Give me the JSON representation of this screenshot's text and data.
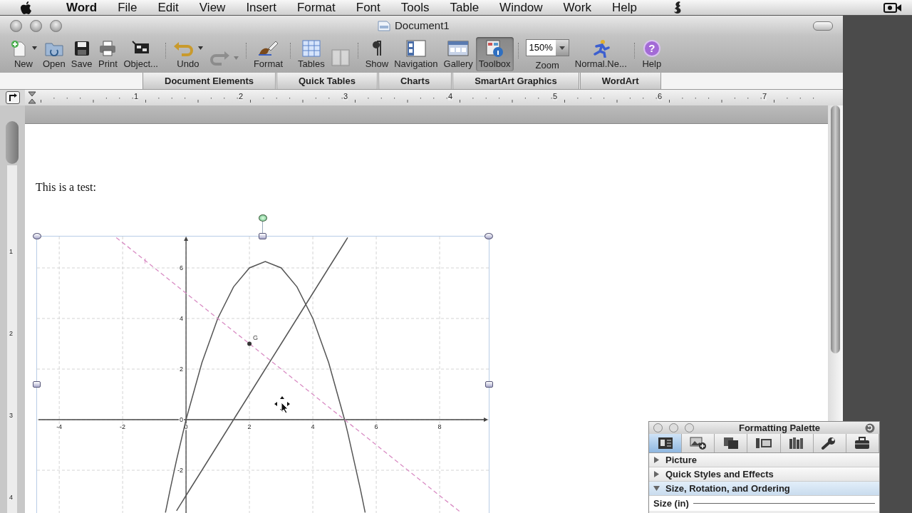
{
  "menu_bar": {
    "items": [
      {
        "label": "Word"
      },
      {
        "label": "File"
      },
      {
        "label": "Edit"
      },
      {
        "label": "View"
      },
      {
        "label": "Insert"
      },
      {
        "label": "Format"
      },
      {
        "label": "Font"
      },
      {
        "label": "Tools"
      },
      {
        "label": "Table"
      },
      {
        "label": "Window"
      },
      {
        "label": "Work"
      },
      {
        "label": "Help"
      }
    ]
  },
  "window": {
    "title": "Document1"
  },
  "toolbar": [
    {
      "kind": "button",
      "label": "New",
      "dropdown": true,
      "disabled": false,
      "selected": false
    },
    {
      "kind": "button",
      "label": "Open",
      "dropdown": false,
      "disabled": false,
      "selected": false
    },
    {
      "kind": "button",
      "label": "Save",
      "dropdown": false,
      "disabled": false,
      "selected": false
    },
    {
      "kind": "button",
      "label": "Print",
      "dropdown": false,
      "disabled": false,
      "selected": false
    },
    {
      "kind": "button",
      "label": "Object...",
      "dropdown": false,
      "disabled": false,
      "selected": false
    },
    {
      "kind": "separator"
    },
    {
      "kind": "button",
      "label": "Undo",
      "dropdown": true,
      "disabled": false,
      "selected": false
    },
    {
      "kind": "button",
      "dropdown": true,
      "disabled": true,
      "selected": false
    },
    {
      "kind": "separator"
    },
    {
      "kind": "button",
      "label": "Format",
      "dropdown": false,
      "disabled": false,
      "selected": false
    },
    {
      "kind": "separator"
    },
    {
      "kind": "button",
      "label": "Tables",
      "dropdown": false,
      "disabled": false,
      "selected": false
    },
    {
      "kind": "button",
      "dropdown": false,
      "disabled": true,
      "selected": false
    },
    {
      "kind": "separator"
    },
    {
      "kind": "button",
      "label": "Show",
      "dropdown": false,
      "disabled": false,
      "selected": false
    },
    {
      "kind": "button",
      "label": "Navigation",
      "dropdown": false,
      "disabled": false,
      "selected": false
    },
    {
      "kind": "button",
      "label": "Gallery",
      "dropdown": false,
      "disabled": false,
      "selected": false
    },
    {
      "kind": "button",
      "label": "Toolbox",
      "dropdown": false,
      "disabled": false,
      "selected": true
    },
    {
      "kind": "separator"
    },
    {
      "kind": "zoom",
      "value": "150%",
      "label": "Zoom"
    },
    {
      "kind": "button",
      "label": "Normal.Ne...",
      "dropdown": false,
      "disabled": false,
      "selected": false
    },
    {
      "kind": "separator"
    },
    {
      "kind": "button",
      "glyph": "?",
      "label": "Help",
      "dropdown": false,
      "disabled": false,
      "selected": false
    }
  ],
  "ribbon": {
    "tabs": [
      {
        "label": "Document Elements",
        "selected": false
      },
      {
        "label": "Quick Tables",
        "selected": false
      },
      {
        "label": "Charts",
        "selected": false
      },
      {
        "label": "SmartArt Graphics",
        "selected": false
      },
      {
        "label": "WordArt",
        "selected": false
      }
    ]
  },
  "ruler": {
    "labels": [
      "1",
      "2",
      "3",
      "4",
      "5",
      "6",
      "7"
    ]
  },
  "vertical_ruler": {
    "labels": [
      "1",
      "2",
      "3",
      "4"
    ]
  },
  "document": {
    "paragraph": "This is a test:",
    "figure": {
      "selected": true,
      "chart_data": {
        "type": "line",
        "grid": true,
        "xlim": [
          -4.7,
          9.55
        ],
        "ylim": [
          -3.69,
          7.24
        ],
        "xticks": [
          -4,
          -2,
          0,
          2,
          4,
          6,
          8
        ],
        "yticks": [
          -2,
          0,
          2,
          4,
          6
        ],
        "x": [
          -2.2,
          -2,
          -1.5,
          -1,
          -0.65,
          -0.5,
          -0.3,
          0,
          0.5,
          1,
          1.5,
          2,
          2.5,
          3,
          3.5,
          4,
          4.5,
          5,
          5.1,
          5.5,
          5.65,
          6,
          6.5,
          7,
          7.5,
          8,
          8.5,
          8.65
        ],
        "series": [
          {
            "color": "#555555",
            "values": [
              null,
              null,
              null,
              null,
              -3.67,
              -2.75,
              -1.59,
              0,
              2.25,
              4,
              5.25,
              6,
              6.25,
              6,
              5.25,
              4,
              2.25,
              0,
              -0.51,
              -2.75,
              -3.67,
              null,
              null,
              null,
              null,
              null,
              null,
              null
            ]
          },
          {
            "color": "#555555",
            "values": [
              null,
              null,
              null,
              null,
              null,
              null,
              -3.6,
              -3,
              -2,
              -1,
              0,
              1,
              2,
              3,
              4,
              5,
              6,
              7,
              7.2,
              null,
              null,
              null,
              null,
              null,
              null,
              null,
              null,
              null
            ]
          },
          {
            "name": "f",
            "color": "#d98cc4",
            "line_style": "dashed",
            "values": [
              7.2,
              7,
              6.5,
              6,
              5.65,
              5.5,
              5.3,
              5,
              4.5,
              4,
              3.5,
              3,
              2.5,
              2,
              1.5,
              1,
              0.5,
              0,
              -0.1,
              -0.5,
              -0.65,
              -1,
              -1.5,
              -2,
              -2.5,
              -3,
              -3.5,
              -3.65
            ]
          }
        ],
        "annotations": [
          {
            "text": "G",
            "x": 2,
            "y": 3
          }
        ]
      }
    }
  },
  "palette": {
    "title": "Formatting Palette",
    "tabs": [
      {
        "selected": true
      },
      {
        "selected": false
      },
      {
        "selected": false
      },
      {
        "selected": false
      },
      {
        "selected": false
      },
      {
        "selected": false
      },
      {
        "selected": false
      }
    ],
    "sections": [
      {
        "label": "Picture",
        "expanded": false
      },
      {
        "label": "Quick Styles and Effects",
        "expanded": false
      },
      {
        "label": "Size, Rotation, and Ordering",
        "expanded": true
      }
    ],
    "group_label": "Size (in)"
  }
}
